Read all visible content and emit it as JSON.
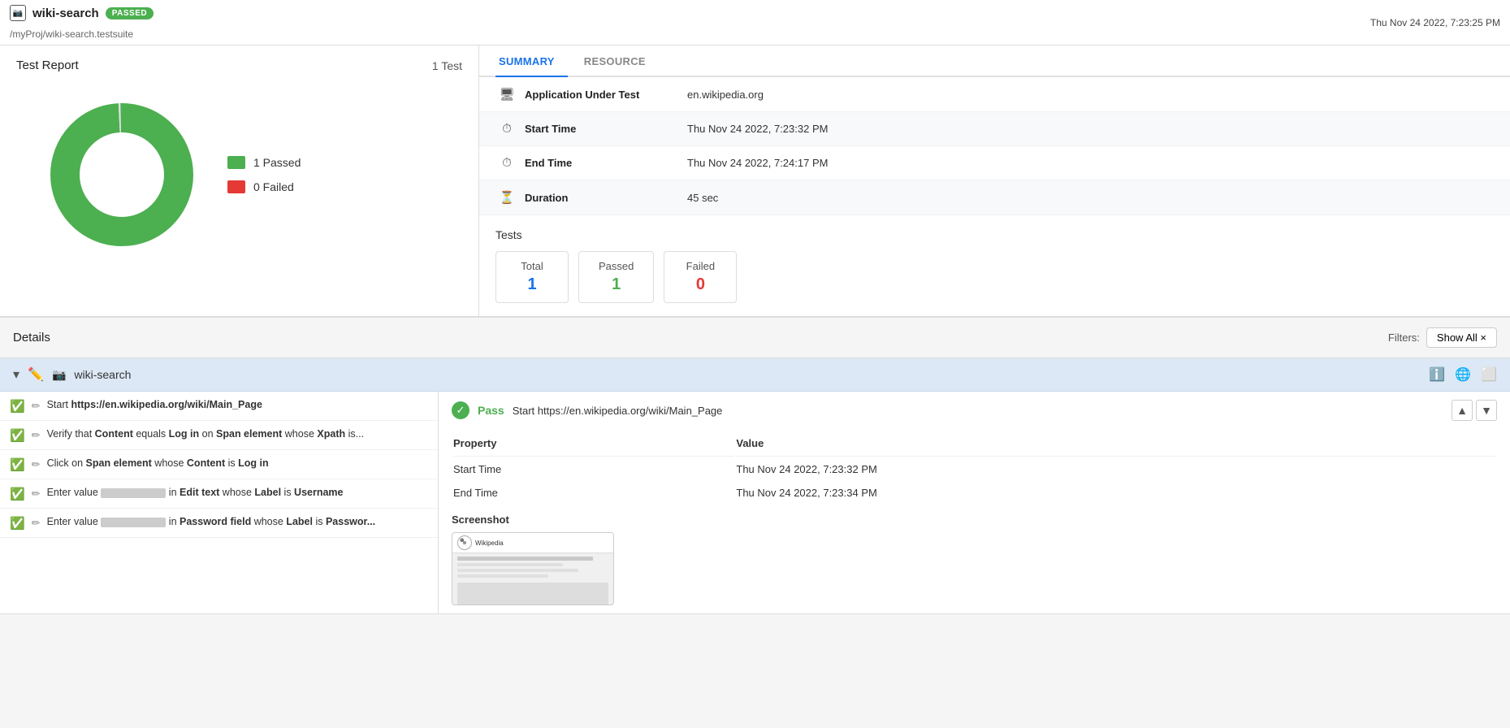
{
  "header": {
    "icon_label": "📷",
    "title": "wiki-search",
    "badge": "PASSED",
    "path": "/myProj/wiki-search.testsuite",
    "datetime": "Thu Nov 24 2022, 7:23:25 PM"
  },
  "left_panel": {
    "title": "Test Report",
    "count_label": "1 Test",
    "chart": {
      "passed_count": 1,
      "failed_count": 0,
      "passed_color": "#4caf50",
      "failed_color": "#e53935"
    },
    "legend": {
      "passed_label": "1 Passed",
      "failed_label": "0 Failed"
    }
  },
  "right_panel": {
    "tabs": [
      {
        "label": "SUMMARY",
        "active": true
      },
      {
        "label": "RESOURCE",
        "active": false
      }
    ],
    "summary_rows": [
      {
        "icon": "🖥",
        "label": "Application Under Test",
        "value": "en.wikipedia.org"
      },
      {
        "icon": "⏱",
        "label": "Start Time",
        "value": "Thu Nov 24 2022, 7:23:32 PM"
      },
      {
        "icon": "⏱",
        "label": "End Time",
        "value": "Thu Nov 24 2022, 7:24:17 PM"
      },
      {
        "icon": "⏳",
        "label": "Duration",
        "value": "45 sec"
      }
    ],
    "tests_section": {
      "title": "Tests",
      "total_label": "Total",
      "total_value": "1",
      "passed_label": "Passed",
      "passed_value": "1",
      "failed_label": "Failed",
      "failed_value": "0"
    }
  },
  "details": {
    "title": "Details",
    "filter_label": "Filters:",
    "filter_btn": "Show All ×",
    "test_name": "wiki-search",
    "steps": [
      {
        "text_html": "Start <b>https://en.wikipedia.org/wiki/Main_Page</b>"
      },
      {
        "text_html": "Verify that <b>Content</b> equals <b>Log in</b> on <b>Span element</b> whose <b>Xpath</b> is..."
      },
      {
        "text_html": "Click on <b>Span element</b> whose <b>Content</b> is <b>Log in</b>"
      },
      {
        "text_html": "Enter value <span class=\"blurred\"></span> in <b>Edit text</b> whose <b>Label</b> is <b>Username</b>"
      },
      {
        "text_html": "Enter value <span class=\"blurred\"></span> in <b>Password field</b> whose <b>Label</b> is <b>Passwor...</b>"
      }
    ],
    "detail_right": {
      "pass_label": "Pass",
      "step_text": "Start https://en.wikipedia.org/wiki/Main_Page",
      "properties": {
        "headers": [
          "Property",
          "Value"
        ],
        "rows": [
          [
            "Start Time",
            "Thu Nov 24 2022, 7:23:32 PM"
          ],
          [
            "End Time",
            "Thu Nov 24 2022, 7:23:34 PM"
          ]
        ]
      },
      "screenshot_label": "Screenshot"
    }
  }
}
